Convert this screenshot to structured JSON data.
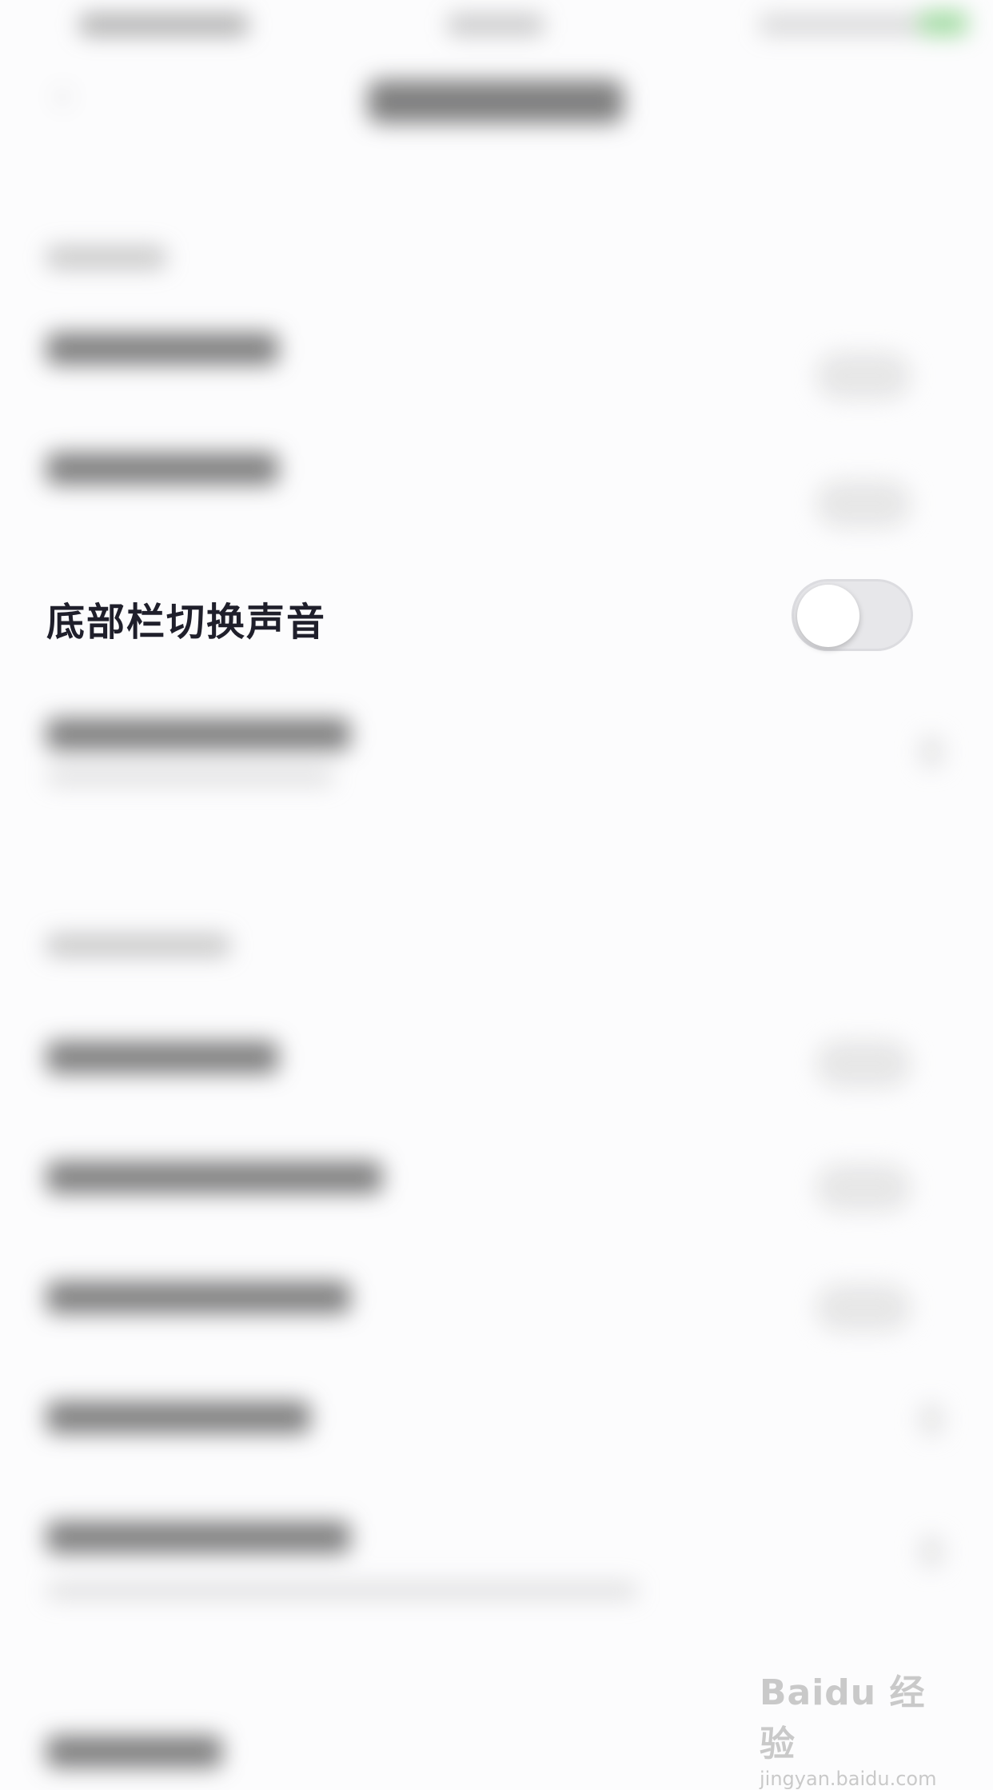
{
  "toggle_row": {
    "label": "底部栏切换声音",
    "switch_on": false
  },
  "watermark": {
    "logo": "Baidu 经验",
    "url": "jingyan.baidu.com"
  },
  "colors": {
    "label": "#1f1f2b",
    "switch_off_track": "#e7e7ea",
    "switch_knob": "#ffffff",
    "background": "#fcfcfd"
  },
  "icons": {
    "back": "chevron-left-icon",
    "battery": "battery-icon"
  }
}
